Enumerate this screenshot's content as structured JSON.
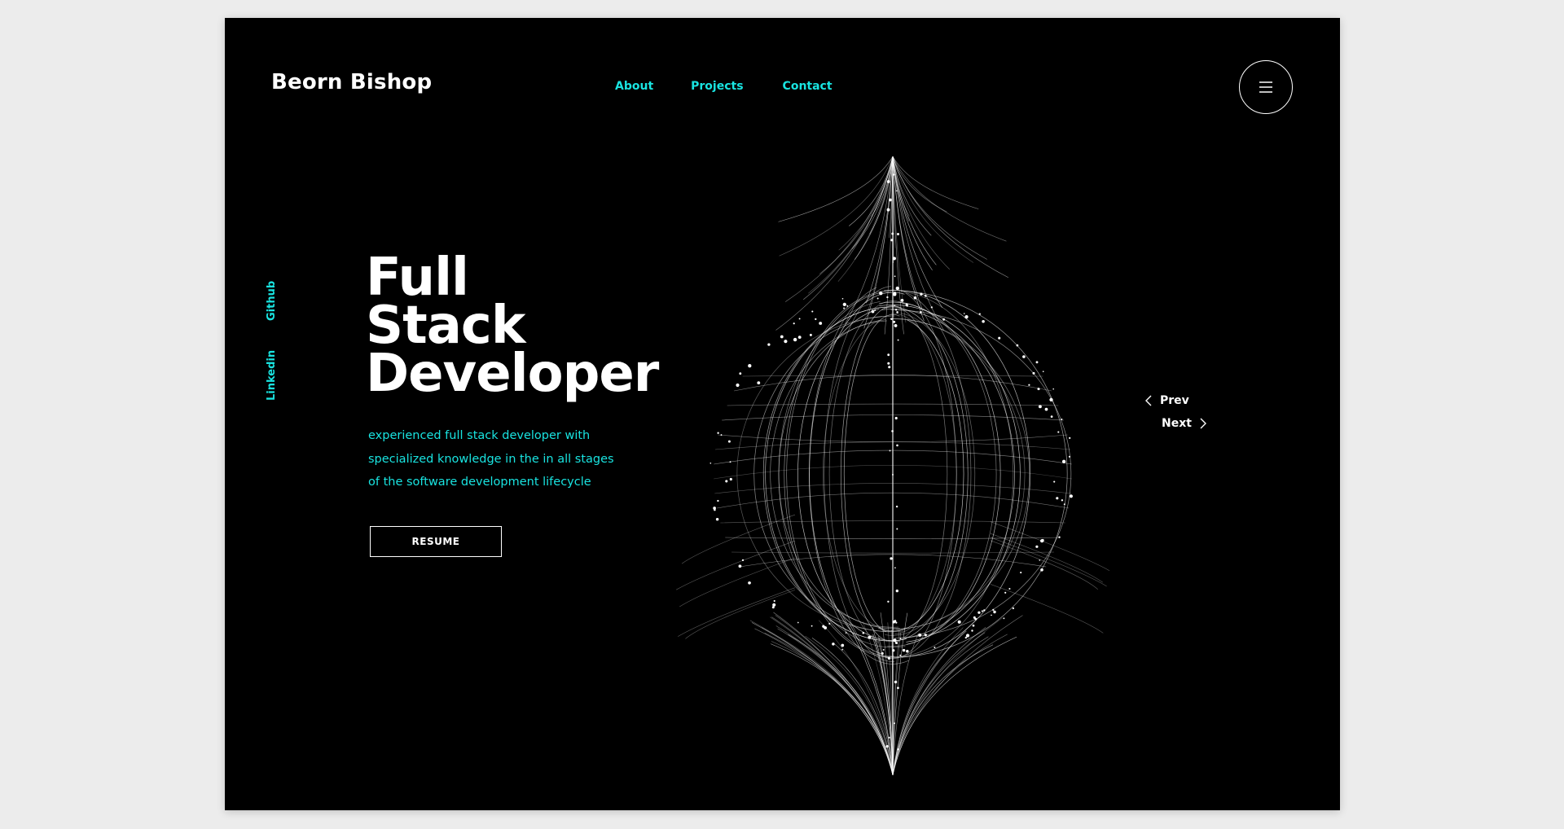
{
  "brand": {
    "name": "Beorn Bishop"
  },
  "nav": {
    "items": [
      {
        "label": "About"
      },
      {
        "label": "Projects"
      },
      {
        "label": "Contact"
      }
    ]
  },
  "menu": {
    "icon": "hamburger-icon"
  },
  "social": {
    "github": "Github",
    "linkedin": "Linkedin"
  },
  "hero": {
    "headline": [
      "Full",
      "Stack",
      "Developer"
    ],
    "description": [
      "experienced full stack developer with",
      "specialized knowledge in the in all stages",
      "of the software development lifecycle"
    ],
    "resume_label": "RESUME"
  },
  "pager": {
    "prev_label": "Prev",
    "next_label": "Next",
    "prev_icon": "chevron-left-icon",
    "next_icon": "chevron-right-icon"
  },
  "colors": {
    "background": "#000000",
    "accent": "#19e3e0",
    "text": "#ffffff",
    "page": "#ececec"
  }
}
